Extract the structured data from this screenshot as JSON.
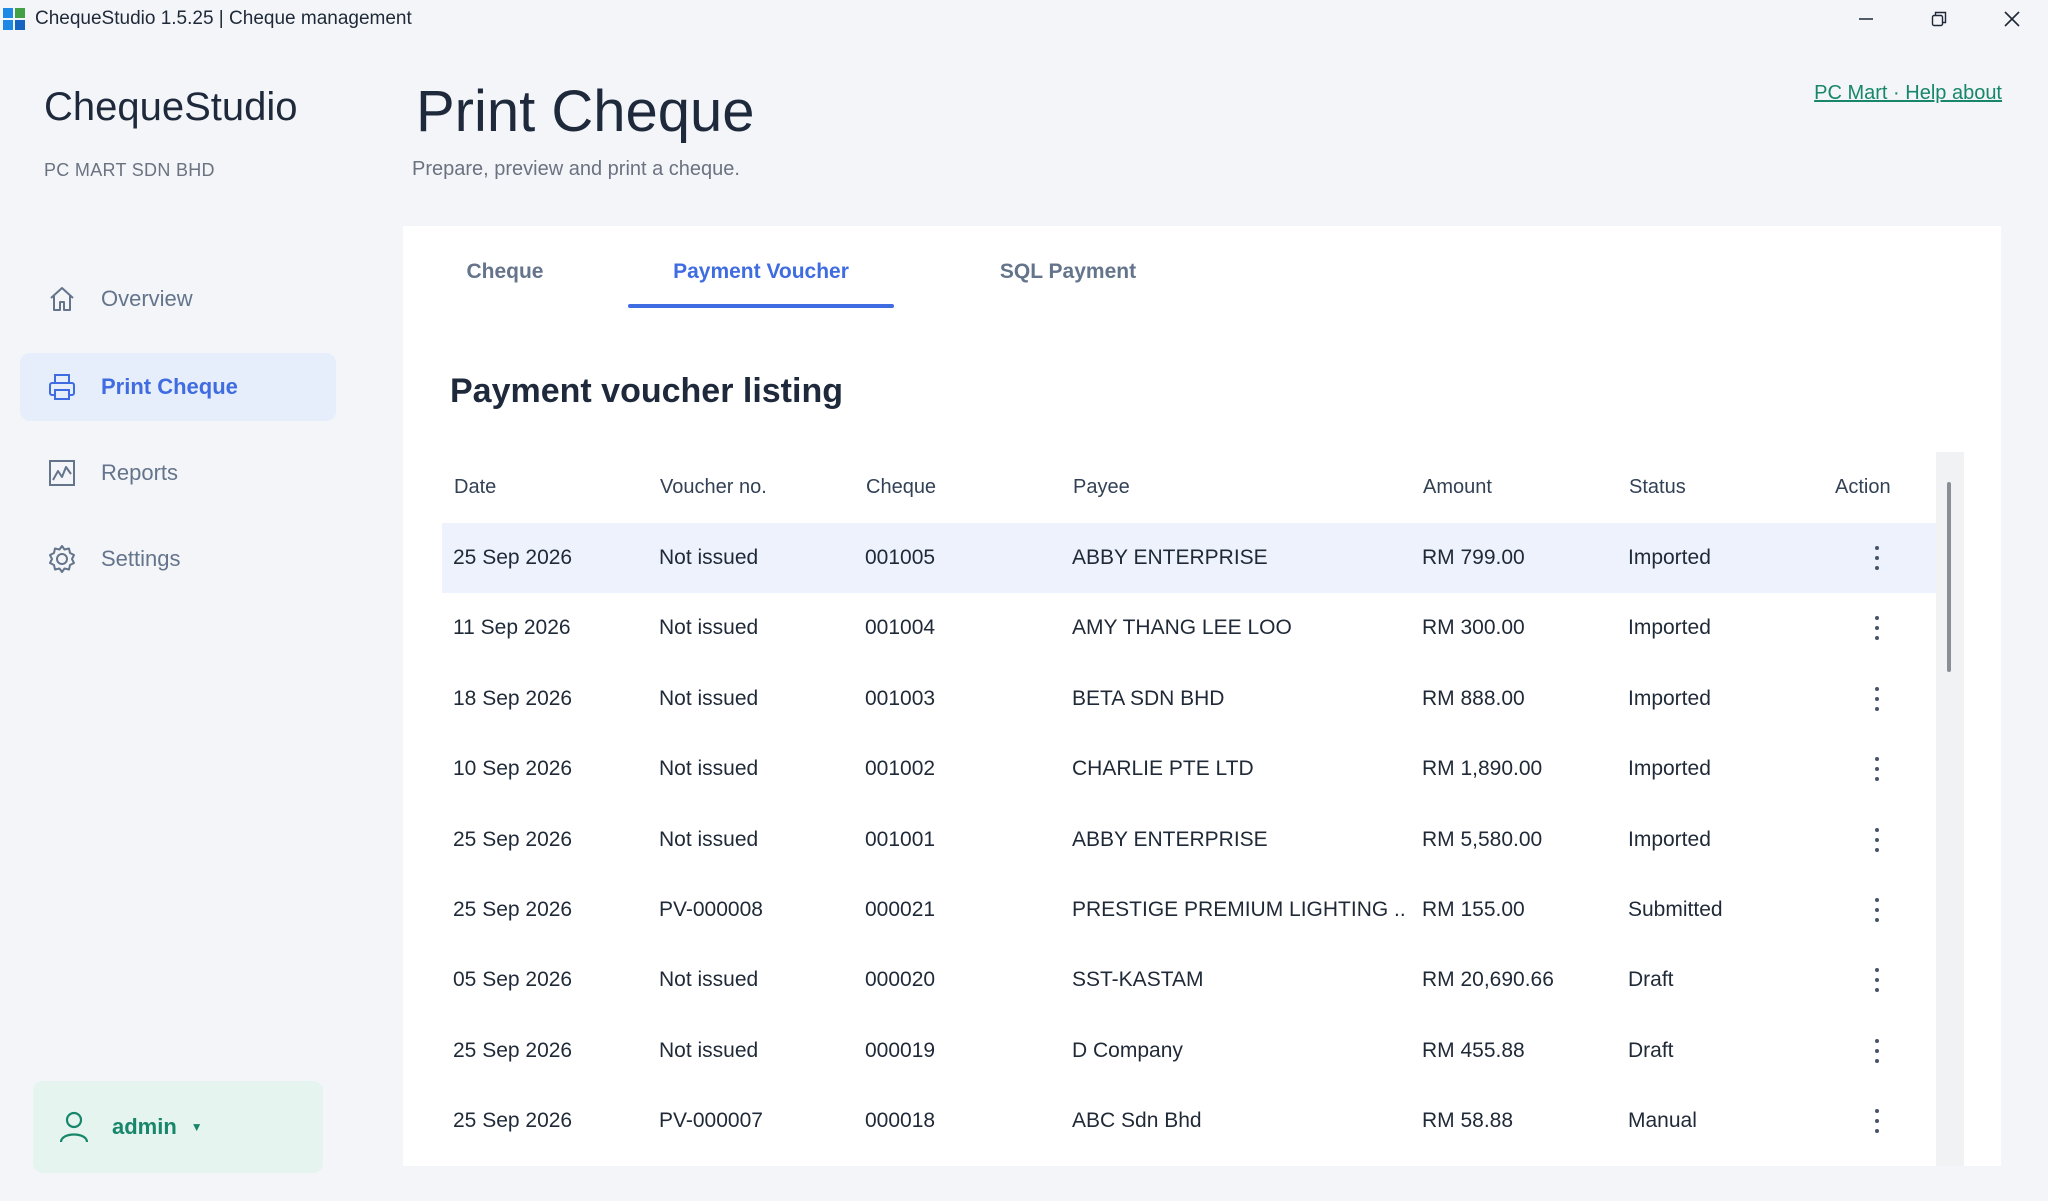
{
  "window": {
    "title": "ChequeStudio 1.5.25 | Cheque management",
    "logo_colors": [
      "#1e88e5",
      "#43a047",
      "#1e88e5",
      "#1565c0"
    ]
  },
  "sidebar": {
    "brand": "ChequeStudio",
    "company": "PC MART SDN BHD",
    "items": [
      {
        "label": "Overview",
        "icon": "home-icon",
        "active": false
      },
      {
        "label": "Print Cheque",
        "icon": "printer-icon",
        "active": true
      },
      {
        "label": "Reports",
        "icon": "chart-icon",
        "active": false
      },
      {
        "label": "Settings",
        "icon": "gear-icon",
        "active": false
      }
    ],
    "user": {
      "name": "admin",
      "caret": "▼"
    }
  },
  "header": {
    "title": "Print Cheque",
    "subtitle": "Prepare, preview and print a cheque.",
    "help_link": "PC Mart · Help  about"
  },
  "tabs": [
    {
      "label": "Cheque",
      "active": false
    },
    {
      "label": "Payment Voucher",
      "active": true
    },
    {
      "label": "SQL Payment",
      "active": false
    }
  ],
  "listing": {
    "title": "Payment voucher listing",
    "columns": [
      "Date",
      "Voucher no.",
      "Cheque",
      "Payee",
      "Amount",
      "Status",
      "Action"
    ],
    "rows": [
      {
        "date": "25 Sep 2026",
        "voucher": "Not issued",
        "cheque": "001005",
        "payee": "ABBY ENTERPRISE",
        "amount": "RM 799.00",
        "status": "Imported",
        "selected": true
      },
      {
        "date": "11 Sep 2026",
        "voucher": "Not issued",
        "cheque": "001004",
        "payee": "AMY THANG LEE LOO",
        "amount": "RM 300.00",
        "status": "Imported",
        "selected": false
      },
      {
        "date": "18 Sep 2026",
        "voucher": "Not issued",
        "cheque": "001003",
        "payee": "BETA SDN BHD",
        "amount": "RM 888.00",
        "status": "Imported",
        "selected": false
      },
      {
        "date": "10 Sep 2026",
        "voucher": "Not issued",
        "cheque": "001002",
        "payee": "CHARLIE PTE LTD",
        "amount": "RM 1,890.00",
        "status": "Imported",
        "selected": false
      },
      {
        "date": "25 Sep 2026",
        "voucher": "Not issued",
        "cheque": "001001",
        "payee": "ABBY ENTERPRISE",
        "amount": "RM 5,580.00",
        "status": "Imported",
        "selected": false
      },
      {
        "date": "25 Sep 2026",
        "voucher": "PV-000008",
        "cheque": "000021",
        "payee": "PRESTIGE PREMIUM LIGHTING  ...",
        "amount": "RM 155.00",
        "status": "Submitted",
        "selected": false
      },
      {
        "date": "05 Sep 2026",
        "voucher": "Not issued",
        "cheque": "000020",
        "payee": "SST-KASTAM",
        "amount": "RM 20,690.66",
        "status": "Draft",
        "selected": false
      },
      {
        "date": "25 Sep 2026",
        "voucher": "Not issued",
        "cheque": "000019",
        "payee": "D Company",
        "amount": "RM 455.88",
        "status": "Draft",
        "selected": false
      },
      {
        "date": "25 Sep 2026",
        "voucher": "PV-000007",
        "cheque": "000018",
        "payee": "ABC Sdn Bhd",
        "amount": "RM 58.88",
        "status": "Manual",
        "selected": false
      }
    ]
  },
  "colors": {
    "accent": "#3f6ce1",
    "brand_green": "#17866a"
  }
}
